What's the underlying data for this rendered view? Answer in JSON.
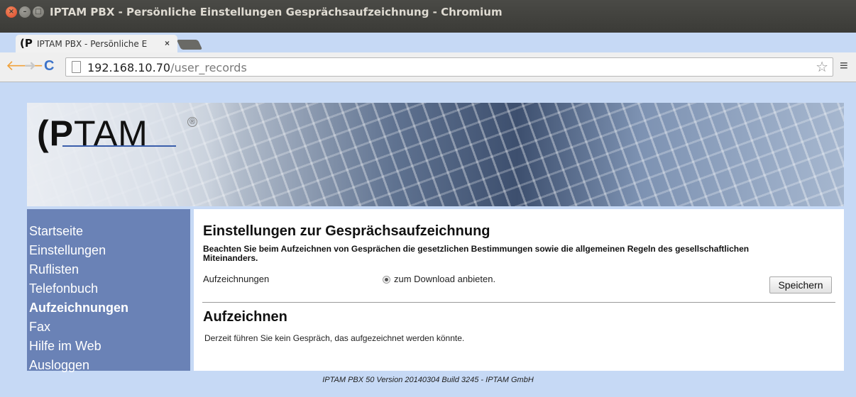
{
  "window": {
    "title": "IPTAM PBX - Persönliche Einstellungen Gesprächsaufzeichnung - Chromium",
    "controls": {
      "close": "×",
      "minimize": "–",
      "maximize": "□"
    }
  },
  "tab": {
    "favicon": "(P",
    "title": "IPTAM PBX - Persönliche E",
    "close": "×"
  },
  "toolbar": {
    "back": "🡐",
    "forward": "➜",
    "reload": "C",
    "url_host": "192.168.10.70",
    "url_path": "/user_records",
    "bookmark": "☆",
    "menu": "≡",
    "icons": {
      "back": "back-arrow-icon",
      "forward": "forward-arrow-icon",
      "reload": "reload-icon",
      "page": "page-icon",
      "bookmark": "star-icon",
      "menu": "hamburger-menu-icon"
    }
  },
  "header": {
    "logo_bold": "(P",
    "logo_light": "TAM",
    "logo_reg": "®"
  },
  "sidebar": {
    "items": [
      {
        "label": "Startseite"
      },
      {
        "label": "Einstellungen"
      },
      {
        "label": "Ruflisten"
      },
      {
        "label": "Telefonbuch"
      },
      {
        "label": "Aufzeichnungen",
        "active": true
      },
      {
        "label": "Fax"
      },
      {
        "label": "Hilfe im Web"
      },
      {
        "label": "Ausloggen"
      }
    ]
  },
  "main": {
    "title": "Einstellungen zur Gesprächsaufzeichnung",
    "notice": "Beachten Sie beim Aufzeichnen von Gesprächen die gesetzlichen Bestimmungen sowie die allgemeinen Regeln des gesellschaftlichen Miteinanders.",
    "recordings_label": "Aufzeichnungen",
    "radio_label": "zum Download anbieten.",
    "radio_checked": true,
    "save_label": "Speichern",
    "record_title": "Aufzeichnen",
    "record_status": "Derzeit führen Sie kein Gespräch, das aufgezeichnet werden könnte."
  },
  "footer": {
    "text": "IPTAM PBX 50 Version 20140304 Build 3245 - IPTAM GmbH"
  },
  "colors": {
    "page_bg": "#c6d9f5",
    "sidebar_bg": "#6a82b6",
    "titlebar_bg": "#3b3b37"
  }
}
